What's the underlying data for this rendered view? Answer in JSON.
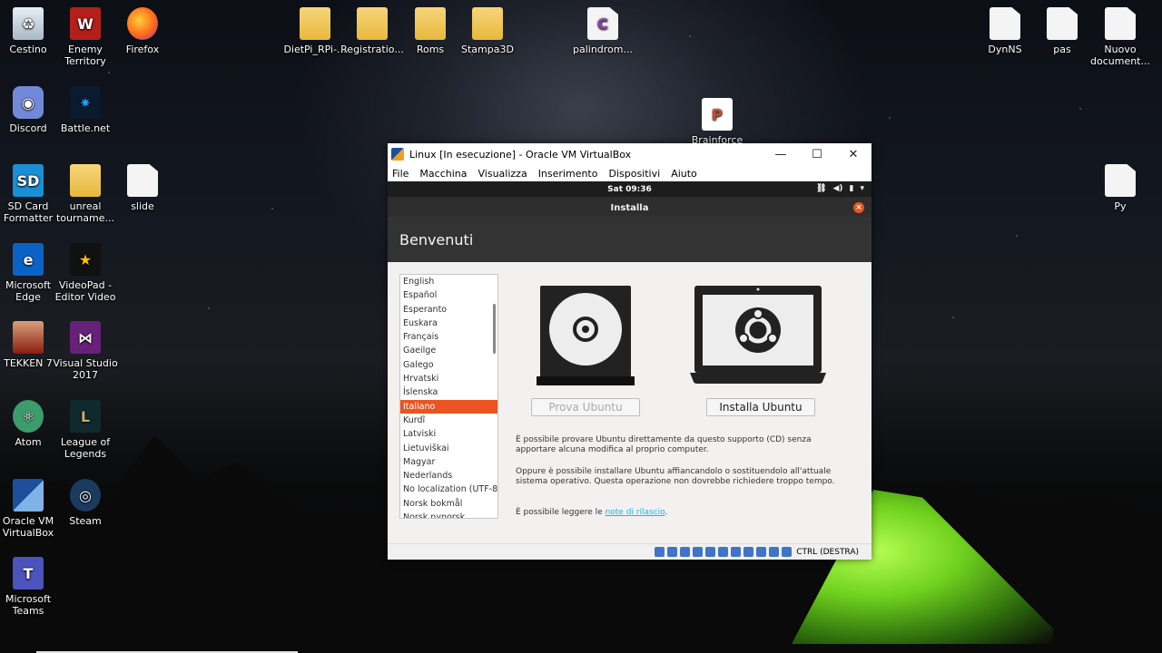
{
  "desktop": {
    "icons": [
      {
        "label": "Cestino",
        "icon": "recycle-bin-icon"
      },
      {
        "label": "Enemy Territory",
        "icon": "enemy-territory-icon"
      },
      {
        "label": "Firefox",
        "icon": "firefox-icon"
      },
      {
        "label": "DietPi_RPi-...",
        "icon": "folder-icon"
      },
      {
        "label": "Registratio...",
        "icon": "folder-icon"
      },
      {
        "label": "Roms",
        "icon": "folder-icon"
      },
      {
        "label": "Stampa3D",
        "icon": "folder-icon"
      },
      {
        "label": "palindrom...",
        "icon": "c-file-icon"
      },
      {
        "label": "DynNS",
        "icon": "document-icon"
      },
      {
        "label": "pas",
        "icon": "document-icon"
      },
      {
        "label": "Nuovo document...",
        "icon": "document-icon"
      },
      {
        "label": "Discord",
        "icon": "discord-icon"
      },
      {
        "label": "Battle.net",
        "icon": "battlenet-icon"
      },
      {
        "label": "Brainforce presentazi...",
        "icon": "powerpoint-icon"
      },
      {
        "label": "SD Card Formatter",
        "icon": "sd-card-icon"
      },
      {
        "label": "unreal tourname...",
        "icon": "folder-icon"
      },
      {
        "label": "slide",
        "icon": "document-icon"
      },
      {
        "label": "Py",
        "icon": "document-icon"
      },
      {
        "label": "Microsoft Edge",
        "icon": "edge-icon"
      },
      {
        "label": "VideoPad - Editor Video",
        "icon": "videopad-icon"
      },
      {
        "label": "TEKKEN 7",
        "icon": "tekken-icon"
      },
      {
        "label": "Visual Studio 2017",
        "icon": "visual-studio-icon"
      },
      {
        "label": "Atom",
        "icon": "atom-icon"
      },
      {
        "label": "League of Legends",
        "icon": "league-of-legends-icon"
      },
      {
        "label": "Oracle VM VirtualBox",
        "icon": "virtualbox-icon"
      },
      {
        "label": "Steam",
        "icon": "steam-icon"
      },
      {
        "label": "Microsoft Teams",
        "icon": "teams-icon"
      }
    ]
  },
  "vbox": {
    "title": "Linux [In esecuzione] - Oracle VM VirtualBox",
    "minimize": "—",
    "maximize": "☐",
    "close": "✕",
    "menu": [
      "File",
      "Macchina",
      "Visualizza",
      "Inserimento",
      "Dispositivi",
      "Aiuto"
    ],
    "status_host_key": "CTRL (DESTRA)"
  },
  "guest": {
    "clock": "Sat 09:36",
    "dialog_title": "Installa",
    "heading": "Benvenuti",
    "languages": [
      "English",
      "Español",
      "Esperanto",
      "Euskara",
      "Français",
      "Gaeilge",
      "Galego",
      "Hrvatski",
      "Íslenska",
      "Italiano",
      "Kurdî",
      "Latviski",
      "Lietuviškai",
      "Magyar",
      "Nederlands",
      "No localization (UTF-8)",
      "Norsk bokmål",
      "Norsk nynorsk"
    ],
    "selected_language": "Italiano",
    "try_button": "Prova Ubuntu",
    "install_button": "Installa Ubuntu",
    "desc1": "È possibile provare Ubuntu direttamente da questo supporto (CD) senza apportare alcuna modifica al proprio computer.",
    "desc2": "Oppure è possibile installare Ubuntu affiancandolo o sostituendolo all'attuale sistema operativo. Questa operazione non dovrebbe richiedere troppo tempo.",
    "desc3_prefix": "È possibile leggere le ",
    "desc3_link": "note di rilascio",
    "desc3_suffix": "."
  },
  "colors": {
    "ubuntu_orange": "#e95420",
    "link": "#19b6ee",
    "tent_green": "#8ee82e"
  }
}
